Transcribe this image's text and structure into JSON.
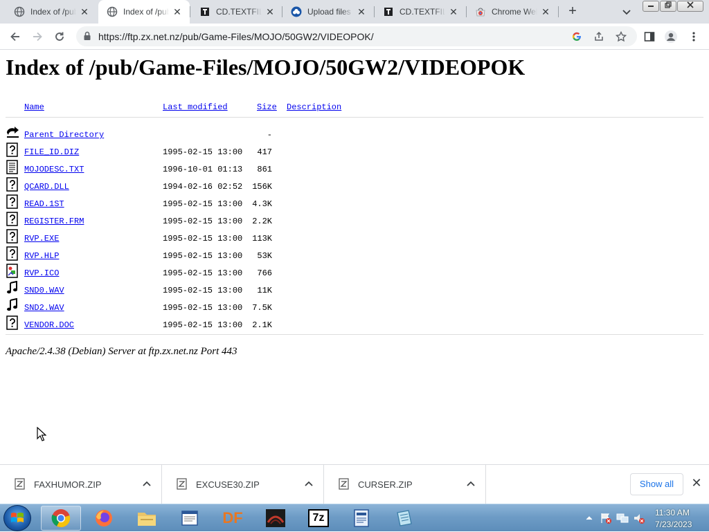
{
  "browser": {
    "tabs": [
      {
        "title": "Index of /pub/Game-Files/MOJO",
        "active": false,
        "icon": "globe-icon"
      },
      {
        "title": "Index of /pub/Game-Files/MOJO",
        "active": true,
        "icon": "globe-icon"
      },
      {
        "title": "CD.TEXTFILES.COM",
        "active": false,
        "icon": "textfiles-icon"
      },
      {
        "title": "Upload files",
        "active": false,
        "icon": "upload-cloud-icon"
      },
      {
        "title": "CD.TEXTFILES.COM",
        "active": false,
        "icon": "textfiles-icon"
      },
      {
        "title": "Chrome Web Store",
        "active": false,
        "icon": "webstore-icon"
      }
    ],
    "new_tab_label": "+",
    "url": "https://ftp.zx.net.nz/pub/Game-Files/MOJO/50GW2/VIDEOPOK/"
  },
  "page": {
    "title": "Index of /pub/Game-Files/MOJO/50GW2/VIDEOPOK",
    "columns": {
      "name": "Name",
      "last_modified": "Last modified",
      "size": "Size",
      "description": "Description"
    },
    "parent": {
      "name": "Parent Directory",
      "size": "-"
    },
    "files": [
      {
        "name": "FILE_ID.DIZ",
        "date": "1995-02-15 13:00",
        "size": "417",
        "icon": "unknown-file-icon"
      },
      {
        "name": "MOJODESC.TXT",
        "date": "1996-10-01 01:13",
        "size": "861",
        "icon": "text-file-icon"
      },
      {
        "name": "QCARD.DLL",
        "date": "1994-02-16 02:52",
        "size": "156K",
        "icon": "unknown-file-icon"
      },
      {
        "name": "READ.1ST",
        "date": "1995-02-15 13:00",
        "size": "4.3K",
        "icon": "unknown-file-icon"
      },
      {
        "name": "REGISTER.FRM",
        "date": "1995-02-15 13:00",
        "size": "2.2K",
        "icon": "unknown-file-icon"
      },
      {
        "name": "RVP.EXE",
        "date": "1995-02-15 13:00",
        "size": "113K",
        "icon": "unknown-file-icon"
      },
      {
        "name": "RVP.HLP",
        "date": "1995-02-15 13:00",
        "size": "53K",
        "icon": "unknown-file-icon"
      },
      {
        "name": "RVP.ICO",
        "date": "1995-02-15 13:00",
        "size": "766",
        "icon": "image-file-icon"
      },
      {
        "name": "SND0.WAV",
        "date": "1995-02-15 13:00",
        "size": "11K",
        "icon": "sound-file-icon"
      },
      {
        "name": "SND2.WAV",
        "date": "1995-02-15 13:00",
        "size": "7.5K",
        "icon": "sound-file-icon"
      },
      {
        "name": "VENDOR.DOC",
        "date": "1995-02-15 13:00",
        "size": "2.1K",
        "icon": "unknown-file-icon"
      }
    ],
    "address": "Apache/2.4.38 (Debian) Server at ftp.zx.net.nz Port 443"
  },
  "downloads": {
    "items": [
      {
        "name": "FAXHUMOR.ZIP"
      },
      {
        "name": "EXCUSE30.ZIP"
      },
      {
        "name": "CURSER.ZIP"
      }
    ],
    "show_all_label": "Show all"
  },
  "taskbar": {
    "apps": [
      "chrome-icon",
      "firefox-icon",
      "explorer-folder-icon",
      "notepad-icon",
      "df-icon",
      "media-app-icon",
      "7zip-icon",
      "document-app-icon",
      "notepad2-icon"
    ],
    "df_label": "DF",
    "zip_label": "7z",
    "time": "11:30 AM",
    "date": "7/23/2023"
  }
}
